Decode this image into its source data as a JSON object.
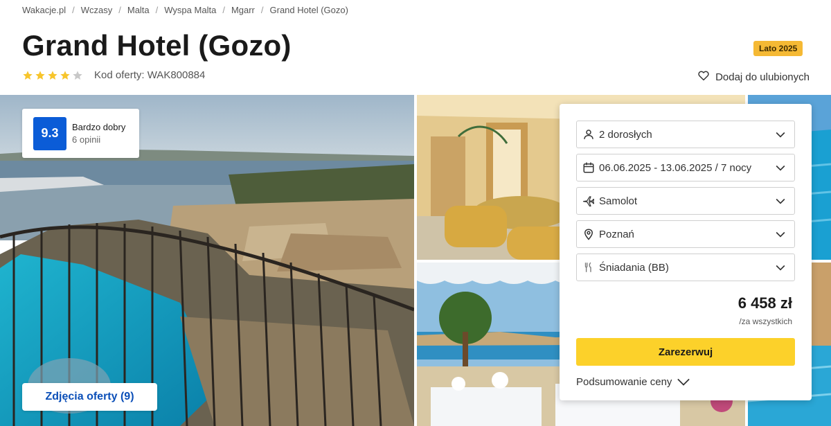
{
  "breadcrumb": {
    "items": [
      "Wakacje.pl",
      "Wczasy",
      "Malta",
      "Wyspa Malta",
      "Mgarr",
      "Grand Hotel (Gozo)"
    ],
    "separator": "/"
  },
  "hotel": {
    "title": "Grand Hotel (Gozo)",
    "stars": 4,
    "max_stars": 5,
    "offer_code": "Kod oferty: WAK800884",
    "season_badge": "Lato 2025"
  },
  "favorites": {
    "label": "Dodaj do ulubionych"
  },
  "review": {
    "score": "9.3",
    "label": "Bardzo dobry",
    "count": "6 opinii"
  },
  "gallery": {
    "button_label": "Zdjęcia oferty (9)"
  },
  "booking": {
    "fields": [
      {
        "icon": "person-icon",
        "value": "2 dorosłych"
      },
      {
        "icon": "calendar-icon",
        "value": "06.06.2025 - 13.06.2025 / 7 nocy"
      },
      {
        "icon": "plane-icon",
        "value": "Samolot"
      },
      {
        "icon": "location-pin-icon",
        "value": "Poznań"
      },
      {
        "icon": "cutlery-icon",
        "value": "Śniadania (BB)"
      }
    ],
    "price": "6 458 zł",
    "price_note": "/za wszystkich",
    "book_label": "Zarezerwuj",
    "summary_label": "Podsumowanie ceny"
  },
  "colors": {
    "accent_blue": "#0b5cd7",
    "book_yellow": "#fcd12a",
    "badge_orange": "#f5b934",
    "star_yellow": "#f7c52c",
    "star_grey": "#c8c8c8"
  }
}
